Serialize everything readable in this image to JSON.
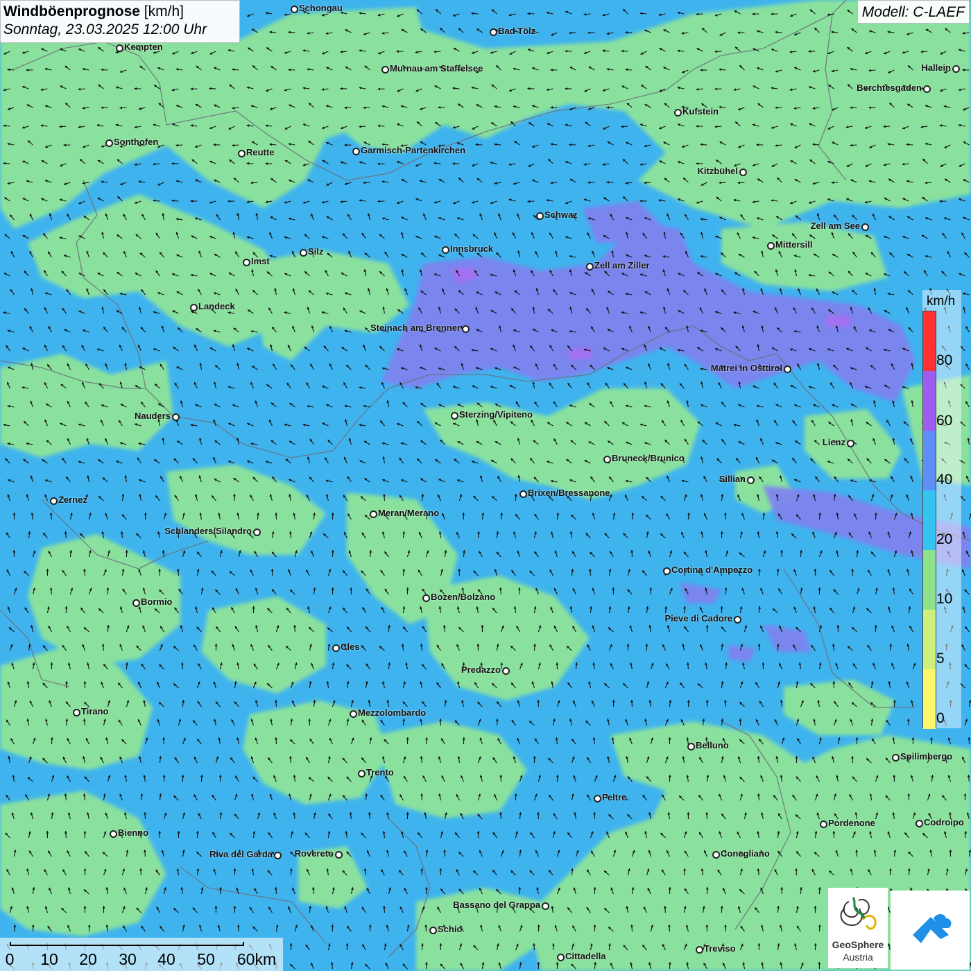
{
  "header": {
    "title_bold": "Windböenprognose",
    "title_unit": " [km/h]",
    "date": "Sonntag, 23.03.2025 12:00 Uhr",
    "model": "Modell: C-LAEF"
  },
  "legend": {
    "unit": "km/h",
    "labels": [
      "80",
      "60",
      "40",
      "20",
      "10",
      "5",
      "0"
    ],
    "colors": [
      "#ff3030",
      "#9f5cf0",
      "#5f8ef8",
      "#33c4f2",
      "#8ee38a",
      "#cdf07a",
      "#fcf66a"
    ]
  },
  "scale": {
    "labels": [
      "0",
      "10",
      "20",
      "30",
      "40",
      "50",
      "60km"
    ]
  },
  "logo": {
    "line1": "GeoSphere",
    "line2": "Austria",
    "icon": "geosphere-swirl-icon",
    "icon2": "cloud-arrow-icon"
  },
  "colors": {
    "sea_blue": "#3fb3ee",
    "green": "#8fe49a",
    "purple": "#7f82ef"
  },
  "cities": [
    {
      "name": "Schongau"
    },
    {
      "name": "Bad Tölz"
    },
    {
      "name": "Kempten"
    },
    {
      "name": "Murnau am Staffelsee"
    },
    {
      "name": "Hallein"
    },
    {
      "name": "Berchtesgaden"
    },
    {
      "name": "Kufstein"
    },
    {
      "name": "Sonthofen"
    },
    {
      "name": "Reutte"
    },
    {
      "name": "Garmisch-Partenkirchen"
    },
    {
      "name": "Kitzbühel"
    },
    {
      "name": "Schwaz"
    },
    {
      "name": "Zell am See"
    },
    {
      "name": "Mittersill"
    },
    {
      "name": "Innsbruck"
    },
    {
      "name": "Silz"
    },
    {
      "name": "Imst"
    },
    {
      "name": "Zell am Ziller"
    },
    {
      "name": "Landeck"
    },
    {
      "name": "Steinach am Brenner"
    },
    {
      "name": "Matrei in Osttirol"
    },
    {
      "name": "Nauders"
    },
    {
      "name": "Sterzing/Vipiteno"
    },
    {
      "name": "Lienz"
    },
    {
      "name": "Bruneck/Brunico"
    },
    {
      "name": "Sillian"
    },
    {
      "name": "Zernez"
    },
    {
      "name": "Brixen/Bressanone"
    },
    {
      "name": "Meran/Merano"
    },
    {
      "name": "Schlanders/Silandro"
    },
    {
      "name": "Cortina d'Ampezzo"
    },
    {
      "name": "Bozen/Bolzano"
    },
    {
      "name": "Bormio"
    },
    {
      "name": "Pieve di Cadore"
    },
    {
      "name": "Cles"
    },
    {
      "name": "Predazzo"
    },
    {
      "name": "Tirano"
    },
    {
      "name": "Mezzolombardo"
    },
    {
      "name": "Belluno"
    },
    {
      "name": "Spilimbergo"
    },
    {
      "name": "Trento"
    },
    {
      "name": "Feltre"
    },
    {
      "name": "Pordenone"
    },
    {
      "name": "Codroipo"
    },
    {
      "name": "Bienno"
    },
    {
      "name": "Riva del Garda"
    },
    {
      "name": "Rovereto"
    },
    {
      "name": "Conegliano"
    },
    {
      "name": "Bassano del Grappa"
    },
    {
      "name": "Schio"
    },
    {
      "name": "Treviso"
    },
    {
      "name": "Cittadella"
    }
  ]
}
